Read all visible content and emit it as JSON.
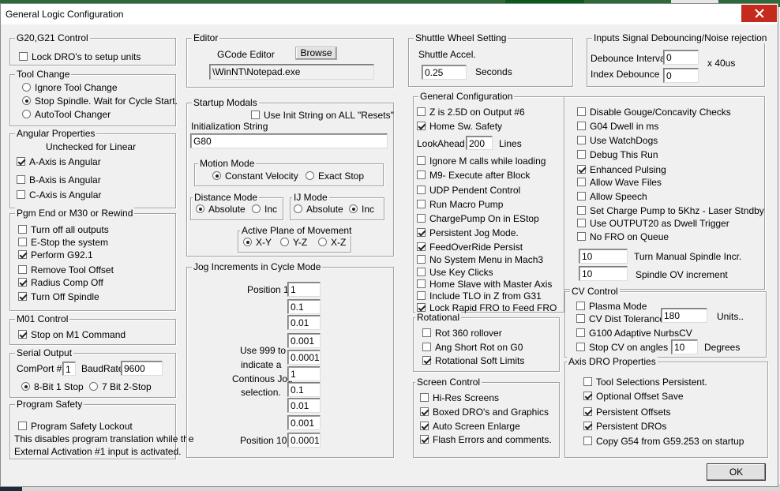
{
  "window": {
    "title": "General Logic Configuration"
  },
  "g20": {
    "title": "G20,G21 Control",
    "lock": {
      "label": "Lock DRO's to setup units",
      "checked": false
    }
  },
  "toolchange": {
    "title": "Tool Change",
    "options": [
      {
        "label": "Ignore Tool Change",
        "selected": false
      },
      {
        "label": "Stop Spindle. Wait for Cycle Start.",
        "selected": true
      },
      {
        "label": "AutoTool Changer",
        "selected": false
      }
    ]
  },
  "angular": {
    "title": "Angular Properties",
    "note": "Unchecked for Linear",
    "items": [
      {
        "label": "A-Axis is Angular",
        "checked": true
      },
      {
        "label": "B-Axis is Angular",
        "checked": false
      },
      {
        "label": "C-Axis is Angular",
        "checked": false
      }
    ]
  },
  "pgmend": {
    "title": "Pgm End or M30 or Rewind",
    "items": [
      {
        "label": "Turn off all outputs",
        "checked": false
      },
      {
        "label": "E-Stop the system",
        "checked": false
      },
      {
        "label": "Perform G92.1",
        "checked": true
      },
      {
        "label": "Remove Tool Offset",
        "checked": false
      },
      {
        "label": "Radius Comp Off",
        "checked": true
      },
      {
        "label": "Turn Off Spindle",
        "checked": true
      }
    ]
  },
  "m01": {
    "title": "M01 Control",
    "stop": {
      "label": "Stop on M1 Command",
      "checked": true
    }
  },
  "serial": {
    "title": "Serial Output",
    "comport_label": "ComPort #",
    "comport": "1",
    "baud_label": "BaudRate",
    "baud": "9600",
    "opt8": {
      "label": "8-Bit 1 Stop",
      "selected": true
    },
    "opt7": {
      "label": "7 Bit 2-Stop",
      "selected": false
    }
  },
  "safety": {
    "title": "Program Safety",
    "lockout": {
      "label": "Program Safety Lockout",
      "checked": false
    },
    "note1": "This disables program translation while the",
    "note2": "External Activation #1 input is activated."
  },
  "editor": {
    "title": "Editor",
    "label": "GCode Editor",
    "browse": "Browse",
    "path": "\\WinNT\\Notepad.exe"
  },
  "startup": {
    "title": "Startup Modals",
    "use_init": {
      "label": "Use Init String on ALL  \"Resets\"",
      "checked": false
    },
    "init_label": "Initialization String",
    "init_value": "G80",
    "motion": {
      "title": "Motion Mode",
      "cv": {
        "label": "Constant Velocity",
        "selected": true
      },
      "es": {
        "label": "Exact Stop",
        "selected": false
      }
    },
    "distance": {
      "title": "Distance Mode",
      "abs": {
        "label": "Absolute",
        "selected": true
      },
      "inc": {
        "label": "Inc",
        "selected": false
      }
    },
    "ij": {
      "title": "IJ Mode",
      "abs": {
        "label": "Absolute",
        "selected": false
      },
      "inc": {
        "label": "Inc",
        "selected": true
      }
    },
    "plane": {
      "title": "Active Plane of Movement",
      "xy": {
        "label": "X-Y",
        "selected": true
      },
      "yz": {
        "label": "Y-Z",
        "selected": false
      },
      "xz": {
        "label": "X-Z",
        "selected": false
      }
    }
  },
  "jog": {
    "title": "Jog Increments in Cycle Mode",
    "pos1": "Position 1",
    "pos10": "Position 10",
    "note": [
      "Use 999 to",
      "indicate a",
      "Continous Jog",
      "selection."
    ],
    "values": [
      "1",
      "0.1",
      "0.01",
      "0.001",
      "0.0001",
      "1",
      "0.1",
      "0.01",
      "0.001",
      "0.0001"
    ]
  },
  "shuttle": {
    "title": "Shuttle Wheel Setting",
    "label": "Shuttle Accel.",
    "value": "0.25",
    "unit": "Seconds"
  },
  "debounce": {
    "title": "Inputs Signal Debouncing/Noise rejection",
    "interval_label": "Debounce Interval",
    "interval": "0",
    "index_label": "Index Debounce",
    "index": "0",
    "unit": "x 40us"
  },
  "general": {
    "title": "General Configuration",
    "col1": [
      {
        "label": "Z is 2.5D on Output #6",
        "checked": false
      },
      {
        "label": "Home Sw. Safety",
        "checked": true
      }
    ],
    "lookahead_label": "LookAhead",
    "lookahead": "200",
    "lookahead_unit": "Lines",
    "col1b": [
      {
        "label": "Ignore M calls while loading",
        "checked": false
      },
      {
        "label": "M9- Execute after Block",
        "checked": false
      },
      {
        "label": "UDP Pendent Control",
        "checked": false
      },
      {
        "label": "Run Macro Pump",
        "checked": false
      },
      {
        "label": "ChargePump On in EStop",
        "checked": false
      },
      {
        "label": "Persistent Jog Mode.",
        "checked": true
      },
      {
        "label": "FeedOverRide Persist",
        "checked": true
      },
      {
        "label": "No System Menu in Mach3",
        "checked": false
      },
      {
        "label": "Use Key Clicks",
        "checked": false
      },
      {
        "label": "Home Slave with Master Axis",
        "checked": false
      },
      {
        "label": "Include TLO in Z from G31",
        "checked": false
      },
      {
        "label": "Lock Rapid FRO to Feed FRO",
        "checked": true
      }
    ],
    "col2": [
      {
        "label": "Disable Gouge/Concavity Checks",
        "checked": false
      },
      {
        "label": "G04 Dwell in ms",
        "checked": false
      },
      {
        "label": "Use WatchDogs",
        "checked": false
      },
      {
        "label": "Debug This Run",
        "checked": false
      },
      {
        "label": "Enhanced Pulsing",
        "checked": true
      },
      {
        "label": "Allow Wave Files",
        "checked": false
      },
      {
        "label": "Allow Speech",
        "checked": false
      },
      {
        "label": "Set Charge Pump to 5Khz  - Laser Stndby",
        "checked": false
      },
      {
        "label": "Use OUTPUT20 as Dwell Trigger",
        "checked": false
      },
      {
        "label": "No FRO on Queue",
        "checked": false
      }
    ],
    "spindle_incr": "10",
    "spindle_incr_label": "Turn Manual Spindle Incr.",
    "spindle_ov": "10",
    "spindle_ov_label": "Spindle OV increment"
  },
  "rotational": {
    "title": "Rotational",
    "items": [
      {
        "label": "Rot 360 rollover",
        "checked": false
      },
      {
        "label": "Ang Short Rot on G0",
        "checked": false
      },
      {
        "label": "Rotational Soft Limits",
        "checked": true
      }
    ]
  },
  "screen": {
    "title": "Screen Control",
    "items": [
      {
        "label": "Hi-Res Screens",
        "checked": false
      },
      {
        "label": "Boxed DRO's and Graphics",
        "checked": true
      },
      {
        "label": "Auto Screen Enlarge",
        "checked": true
      },
      {
        "label": "Flash Errors and comments.",
        "checked": true
      }
    ]
  },
  "cv": {
    "title": "CV Control",
    "plasma": {
      "label": "Plasma Mode",
      "checked": false
    },
    "dist": {
      "label": "CV Dist Tolerance",
      "checked": false
    },
    "dist_value": "180",
    "dist_unit": "Units..",
    "g100": {
      "label": "G100 Adaptive NurbsCV",
      "checked": false
    },
    "stop": {
      "label": "Stop CV on angles >",
      "checked": false
    },
    "angle_value": "10",
    "angle_unit": "Degrees"
  },
  "axisdro": {
    "title": "Axis DRO Properties",
    "items": [
      {
        "label": "Tool Selections Persistent.",
        "checked": false
      },
      {
        "label": "Optional Offset Save",
        "checked": true
      },
      {
        "label": "Persistent Offsets",
        "checked": true
      },
      {
        "label": "Persistent DROs",
        "checked": true
      },
      {
        "label": "Copy G54 from G59.253 on startup",
        "checked": false
      }
    ]
  },
  "ok": "OK"
}
